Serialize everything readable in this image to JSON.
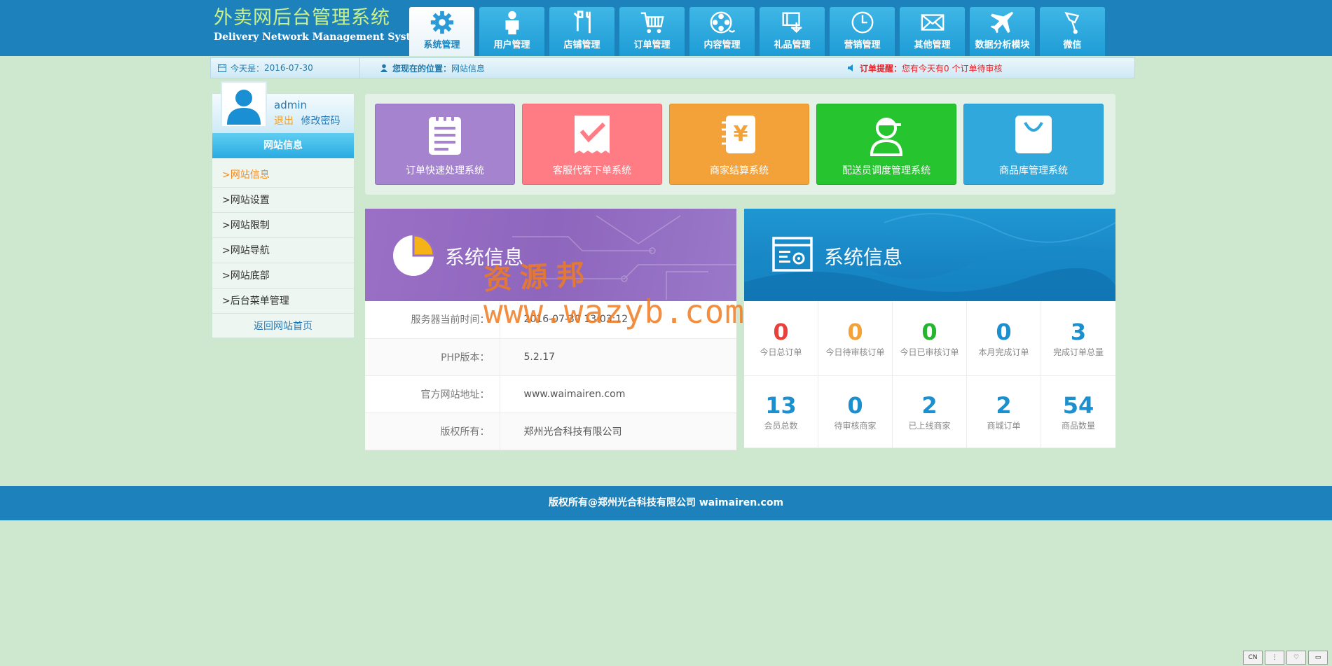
{
  "logo": {
    "cn": "外卖网后台管理系统",
    "en": "Delivery Network Management System"
  },
  "nav": [
    {
      "label": "系统管理",
      "icon": "gear-icon",
      "active": true
    },
    {
      "label": "用户管理",
      "icon": "user-icon"
    },
    {
      "label": "店铺管理",
      "icon": "tools-icon"
    },
    {
      "label": "订单管理",
      "icon": "cart-icon"
    },
    {
      "label": "内容管理",
      "icon": "film-reel-icon"
    },
    {
      "label": "礼品管理",
      "icon": "gift-box-icon"
    },
    {
      "label": "营销管理",
      "icon": "clock-icon"
    },
    {
      "label": "其他管理",
      "icon": "mail-icon"
    },
    {
      "label": "数据分析模块",
      "icon": "airplane-icon"
    },
    {
      "label": "微信",
      "icon": "wechat-icon"
    }
  ],
  "infobar": {
    "date_label": "今天是：",
    "date_value": "2016-07-30",
    "location_label": "您现在的位置：",
    "location_value": "网站信息",
    "order_label": "订单提醒：",
    "order_text": "您有今天有0 个订单待审核"
  },
  "user": {
    "name": "admin",
    "logout": "退出",
    "change_password": "修改密码"
  },
  "sidebar": {
    "title": "网站信息",
    "items": [
      {
        "label": ">网站信息",
        "active": true
      },
      {
        "label": ">网站设置"
      },
      {
        "label": ">网站限制"
      },
      {
        "label": ">网站导航"
      },
      {
        "label": ">网站底部"
      },
      {
        "label": ">后台菜单管理"
      }
    ],
    "back": "返回网站首页"
  },
  "tiles": [
    {
      "label": "订单快速处理系统",
      "icon": "clipboard-list-icon"
    },
    {
      "label": "客服代客下单系统",
      "icon": "checkmark-receipt-icon"
    },
    {
      "label": "商家结算系统",
      "icon": "yen-notebook-icon"
    },
    {
      "label": "配送员调度管理系统",
      "icon": "courier-icon"
    },
    {
      "label": "商品库管理系统",
      "icon": "shopping-bag-icon"
    }
  ],
  "system_info": {
    "title": "系统信息",
    "rows": [
      {
        "key": "服务器当前时间：",
        "value": "2016-07-30 13:03:12"
      },
      {
        "key": "PHP版本：",
        "value": "5.2.17"
      },
      {
        "key": "官方网站地址：",
        "value": "www.waimairen.com"
      },
      {
        "key": "版权所有：",
        "value": "郑州光合科技有限公司"
      }
    ]
  },
  "stats_panel": {
    "title": "系统信息",
    "items": [
      {
        "value": "0",
        "label": "今日总订单",
        "color": "#e8413b"
      },
      {
        "value": "0",
        "label": "今日待审核订单",
        "color": "#f3a23a"
      },
      {
        "value": "0",
        "label": "今日已审核订单",
        "color": "#25b52e"
      },
      {
        "value": "0",
        "label": "本月完成订单",
        "color": "#1c8fcf"
      },
      {
        "value": "3",
        "label": "完成订单总量",
        "color": "#1c8fcf"
      },
      {
        "value": "13",
        "label": "会员总数",
        "color": "#1c8fcf"
      },
      {
        "value": "0",
        "label": "待审核商家",
        "color": "#1c8fcf"
      },
      {
        "value": "2",
        "label": "已上线商家",
        "color": "#1c8fcf"
      },
      {
        "value": "2",
        "label": "商城订单",
        "color": "#1c8fcf"
      },
      {
        "value": "54",
        "label": "商品数量",
        "color": "#1c8fcf"
      }
    ]
  },
  "watermark": {
    "line1": "资源邦",
    "line2": "www.wazyb.com"
  },
  "footer": "版权所有@郑州光合科技有限公司 waimairen.com",
  "tray": [
    "CN",
    "⋮",
    "♡",
    "▭"
  ]
}
